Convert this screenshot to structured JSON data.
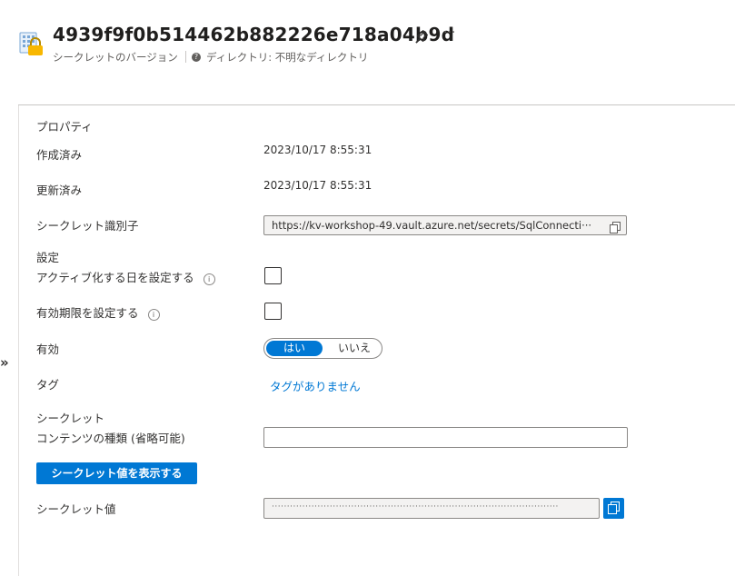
{
  "header": {
    "title": "4939f9f0b514462b882226e718a04b9d",
    "subtitle": "シークレットのバージョン",
    "directory": "ディレクトリ: 不明なディレクトリ",
    "more_label": "···"
  },
  "properties": {
    "section": "プロパティ",
    "created_label": "作成済み",
    "created_value": "2023/10/17 8:55:31",
    "updated_label": "更新済み",
    "updated_value": "2023/10/17 8:55:31",
    "identifier_label": "シークレット識別子",
    "identifier_value": "https://kv-workshop-49.vault.azure.net/secrets/SqlConnecti···"
  },
  "settings": {
    "section": "設定",
    "activation_label": "アクティブ化する日を設定する",
    "expiration_label": "有効期限を設定する",
    "enabled_label": "有効",
    "enabled_yes": "はい",
    "enabled_no": "いいえ",
    "tags_label": "タグ",
    "tags_link": "タグがありません"
  },
  "secret": {
    "section": "シークレット",
    "content_type_label": "コンテンツの種類 (省略可能)",
    "show_button": "シークレット値を表示する",
    "value_label": "シークレット値",
    "value_mask": "······························································································"
  },
  "colors": {
    "accent": "#0078d4",
    "text": "#323130"
  }
}
